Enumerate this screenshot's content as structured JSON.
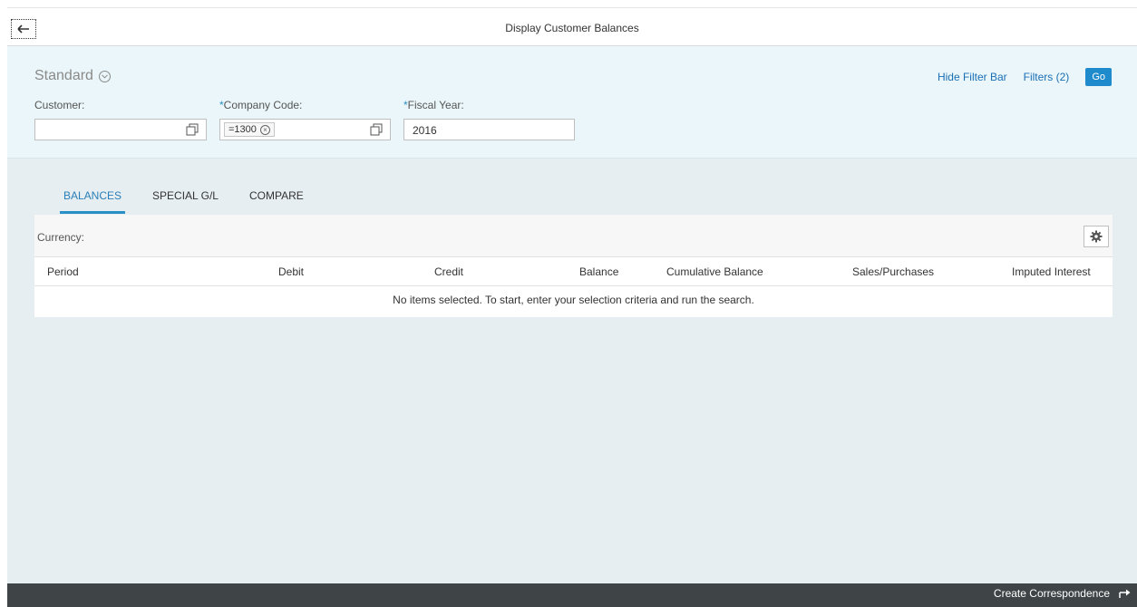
{
  "header": {
    "title": "Display Customer Balances",
    "back_icon": "arrow-left-icon"
  },
  "filter_bar": {
    "variant": "Standard",
    "hide_filter_bar": "Hide Filter Bar",
    "filters": "Filters (2)",
    "go": "Go",
    "fields": {
      "customer": {
        "label": "Customer:",
        "value": ""
      },
      "company_code": {
        "required_mark": "*",
        "label": "Company Code:",
        "token": "=1300"
      },
      "fiscal_year": {
        "required_mark": "*",
        "label": "Fiscal Year:",
        "value": "2016"
      }
    }
  },
  "tabs": [
    "BALANCES",
    "SPECIAL G/L",
    "COMPARE"
  ],
  "active_tab": "BALANCES",
  "table": {
    "currency_label": "Currency:",
    "columns": [
      "Period",
      "Debit",
      "Credit",
      "Balance",
      "Cumulative Balance",
      "Sales/Purchases",
      "Imputed Interest"
    ],
    "no_data_text": "No items selected. To start, enter your selection criteria and run the search."
  },
  "footer": {
    "action": "Create Correspondence"
  },
  "colors": {
    "accent": "#1f8bcc",
    "filter_bar_bg": "#eaf6f9",
    "content_bg": "#e6eef1",
    "footer_bg": "#3f4447"
  }
}
